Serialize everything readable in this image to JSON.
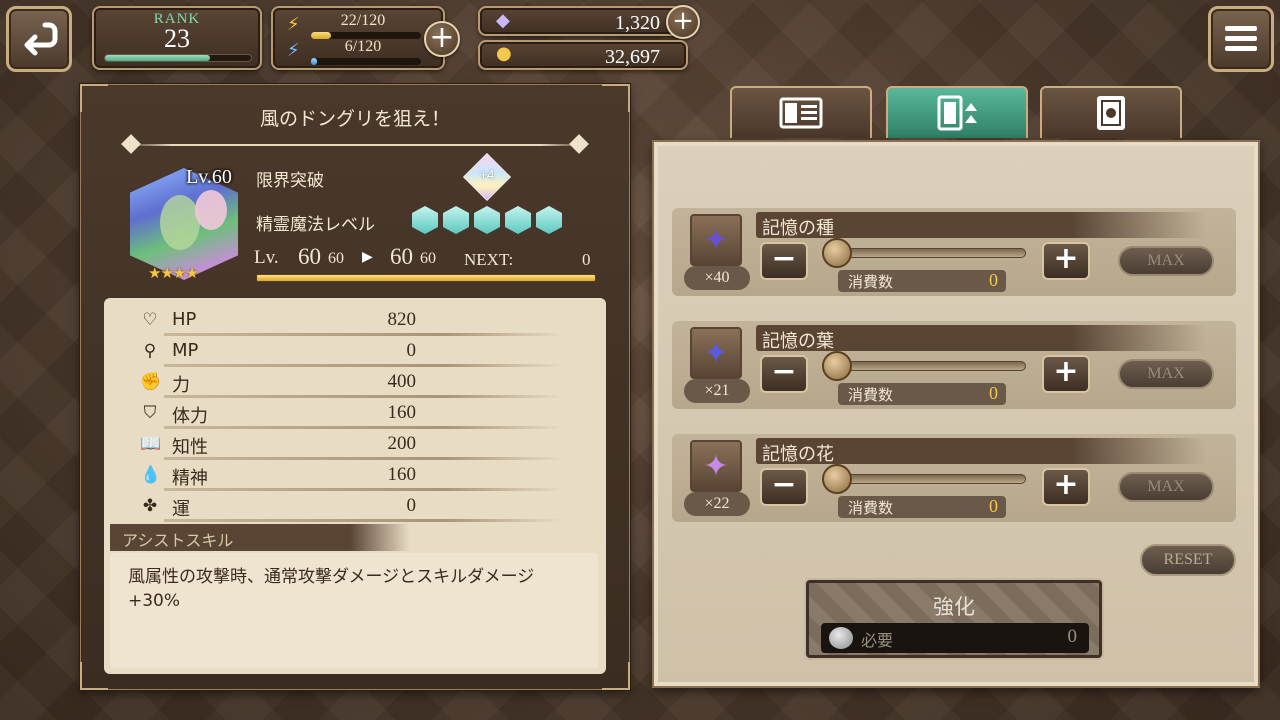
{
  "header": {
    "rank_label": "RANK",
    "rank_value": "23",
    "rank_progress": 0.72,
    "stamina_text": "22/120",
    "stamina_progress": 0.18,
    "mana_text": "6/120",
    "mana_progress": 0.05,
    "gems": "1,320",
    "gold": "32,697"
  },
  "quest": {
    "title": "風のドングリを狙え！"
  },
  "character": {
    "level_badge": "Lv.60",
    "limit_break_label": "限界突破",
    "limit_break_value": "+4",
    "spirit_magic_label": "精霊魔法レベル",
    "spirit_magic_count": 5,
    "stars": 4,
    "lv_label": "Lv.",
    "lv_current": "60",
    "lv_current_max": "60",
    "lv_next": "60",
    "lv_next_max": "60",
    "next_label": "NEXT:",
    "next_value": "0",
    "exp_progress": 1.0
  },
  "stats": [
    {
      "icon": "heart-icon",
      "glyph": "♡",
      "name": "HP",
      "value": "820"
    },
    {
      "icon": "mp-icon",
      "glyph": "⚲",
      "name": "MP",
      "value": "0"
    },
    {
      "icon": "power-icon",
      "glyph": "✊",
      "name": "力",
      "value": "400"
    },
    {
      "icon": "shield-icon",
      "glyph": "⛉",
      "name": "体力",
      "value": "160"
    },
    {
      "icon": "book-icon",
      "glyph": "📖",
      "name": "知性",
      "value": "200"
    },
    {
      "icon": "drop-icon",
      "glyph": "💧",
      "name": "精神",
      "value": "160"
    },
    {
      "icon": "clover-icon",
      "glyph": "✤",
      "name": "運",
      "value": "0"
    }
  ],
  "assist": {
    "header": "アシストスキル",
    "description": "風属性の攻撃時、通常攻撃ダメージとスキルダメージ+30%"
  },
  "tabs": [
    {
      "icon": "profile-card-icon"
    },
    {
      "icon": "enhance-card-icon"
    },
    {
      "icon": "card-icon"
    }
  ],
  "materials": [
    {
      "name": "記憶の種",
      "count": "×40",
      "consume_label": "消費数",
      "consume_value": "0",
      "max_label": "MAX",
      "color": "#6a4fd0"
    },
    {
      "name": "記憶の葉",
      "count": "×21",
      "consume_label": "消費数",
      "consume_value": "0",
      "max_label": "MAX",
      "color": "#5a5adc"
    },
    {
      "name": "記憶の花",
      "count": "×22",
      "consume_label": "消費数",
      "consume_value": "0",
      "max_label": "MAX",
      "color": "#c68ae8"
    }
  ],
  "reset_label": "RESET",
  "enhance": {
    "label": "強化",
    "required_label": "必要",
    "required_value": "0"
  }
}
